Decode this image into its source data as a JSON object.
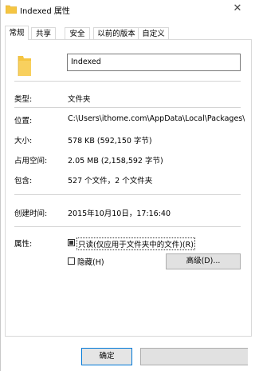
{
  "window": {
    "title": "Indexed 属性",
    "close_glyph": "✕"
  },
  "tabs": [
    {
      "label": "常规",
      "active": true
    },
    {
      "label": "共享",
      "active": false
    },
    {
      "label": "安全",
      "active": false
    },
    {
      "label": "以前的版本",
      "active": false
    },
    {
      "label": "自定义",
      "active": false
    }
  ],
  "general": {
    "folder_name": "Indexed",
    "type_label": "类型:",
    "type_value": "文件夹",
    "location_label": "位置:",
    "location_value": "C:\\Users\\ithome.com\\AppData\\Local\\Packages\\w",
    "size_label": "大小:",
    "size_value": "578 KB (592,150 字节)",
    "size_on_disk_label": "占用空间:",
    "size_on_disk_value": "2.05 MB (2,158,592 字节)",
    "contains_label": "包含:",
    "contains_value": "527 个文件，2 个文件夹",
    "created_label": "创建时间:",
    "created_value": "2015年10月10日，17:16:40",
    "attributes_label": "属性:",
    "readonly_label": "只读(仅应用于文件夹中的文件)(R)",
    "hidden_label": "隐藏(H)",
    "advanced_button": "高级(D)..."
  },
  "footer": {
    "ok_button": "确定"
  },
  "colors": {
    "accent": "#0078d7",
    "folder": "#f5c542"
  },
  "icons": {
    "title": "folder-icon",
    "main": "folder-icon"
  }
}
